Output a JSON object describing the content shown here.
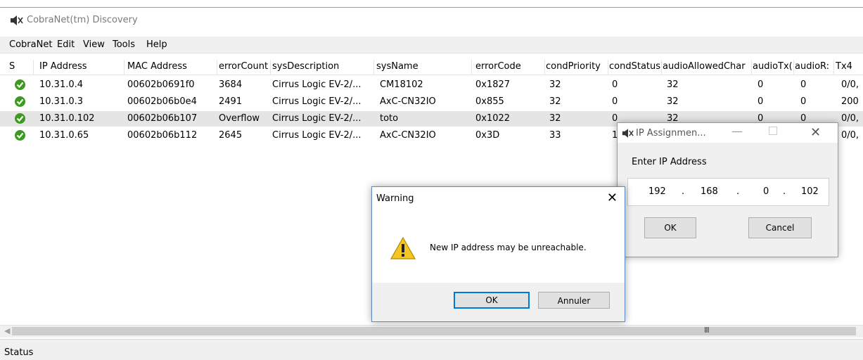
{
  "window": {
    "title": "CobraNet(tm) Discovery"
  },
  "menu": [
    "CobraNet",
    "Edit",
    "View",
    "Tools",
    "Help"
  ],
  "columns": [
    "S",
    "IP Address",
    "MAC Address",
    "errorCount",
    "sysDescription",
    "sysName",
    "errorCode",
    "condPriority",
    "condStatus",
    "audioAllowedChar",
    "audioTx(",
    "audioR:",
    "Tx4"
  ],
  "rows": [
    {
      "ip": "10.31.0.4",
      "mac": "00602b0691f0",
      "err": "3684",
      "desc": "Cirrus Logic EV-2/...",
      "name": "CM18102",
      "code": "0x1827",
      "prio": "32",
      "cond": "0",
      "allowed": "32",
      "tx": "0",
      "rx": "0",
      "tx4": "0/0,"
    },
    {
      "ip": "10.31.0.3",
      "mac": "00602b06b0e4",
      "err": "2491",
      "desc": "Cirrus Logic EV-2/...",
      "name": "AxC-CN32IO",
      "code": "0x855",
      "prio": "32",
      "cond": "0",
      "allowed": "32",
      "tx": "0",
      "rx": "0",
      "tx4": "200"
    },
    {
      "ip": "10.31.0.102",
      "mac": "00602b06b107",
      "err": "Overflow",
      "desc": "Cirrus Logic EV-2/...",
      "name": "toto",
      "code": "0x1022",
      "prio": "32",
      "cond": "0",
      "allowed": "32",
      "tx": "0",
      "rx": "0",
      "tx4": "0/0,"
    },
    {
      "ip": "10.31.0.65",
      "mac": "00602b06b112",
      "err": "2645",
      "desc": "Cirrus Logic EV-2/...",
      "name": "AxC-CN32IO",
      "code": "0x3D",
      "prio": "33",
      "cond": "1",
      "allowed": "",
      "tx": "",
      "rx": "",
      "tx4": "0/0,"
    }
  ],
  "status": "Status",
  "scroll_grip": "III",
  "warning": {
    "title": "Warning",
    "message": "New IP address may be unreachable.",
    "ok": "OK",
    "cancel": "Annuler",
    "close": "✕"
  },
  "ip_dialog": {
    "title": "IP Assignmen...",
    "label": "Enter IP Address",
    "octets": [
      "192",
      "168",
      "0",
      "102"
    ],
    "dot": ".",
    "ok": "OK",
    "cancel": "Cancel",
    "minimize": "—",
    "close": "✕"
  }
}
